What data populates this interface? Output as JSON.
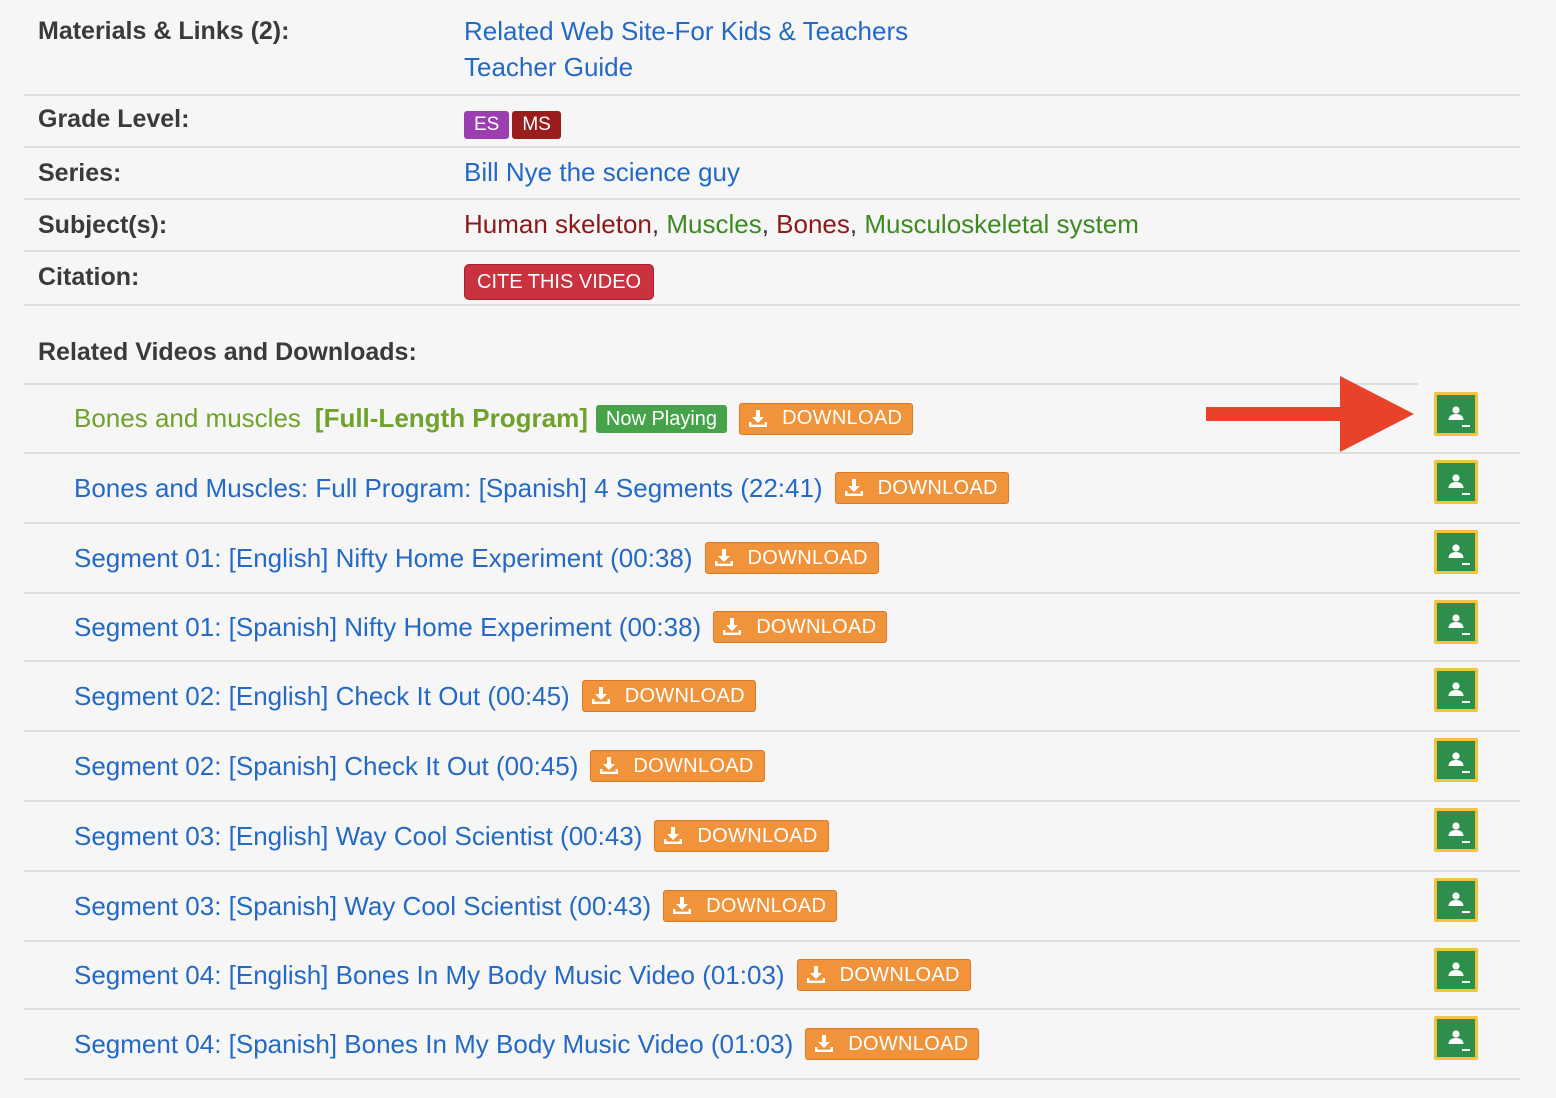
{
  "materials": {
    "label": "Materials & Links (2):",
    "links": [
      "Related Web Site-For Kids & Teachers",
      "Teacher Guide"
    ]
  },
  "grade": {
    "label": "Grade Level:",
    "badges": [
      {
        "text": "ES",
        "color": "#9b3fb0"
      },
      {
        "text": "MS",
        "color": "#9a1c1c"
      }
    ]
  },
  "series": {
    "label": "Series:",
    "value": "Bill Nye the science guy"
  },
  "subjects": {
    "label": "Subject(s):",
    "items": [
      "Human skeleton",
      "Muscles",
      "Bones",
      "Musculoskeletal system"
    ],
    "separator": ", "
  },
  "citation": {
    "label": "Citation:",
    "button": "CITE THIS VIDEO"
  },
  "related": {
    "title": "Related Videos and Downloads:",
    "download_label": "DOWNLOAD",
    "now_playing_label": "Now Playing",
    "full_length_label": "[Full-Length Program]",
    "videos": [
      "Bones and muscles",
      "Bones and Muscles: Full Program: [Spanish] 4 Segments (22:41)",
      "Segment 01: [English] Nifty Home Experiment (00:38)",
      "Segment 01: [Spanish] Nifty Home Experiment (00:38)",
      "Segment 02: [English] Check It Out (00:45)",
      "Segment 02: [Spanish] Check It Out (00:45)",
      "Segment 03: [English] Way Cool Scientist (00:43)",
      "Segment 03: [Spanish] Way Cool Scientist (00:43)",
      "Segment 04: [English] Bones In My Body Music Video (01:03)",
      "Segment 04: [Spanish] Bones In My Body Music Video (01:03)"
    ]
  },
  "colors": {
    "link": "#2469c4",
    "playing": "#6ea22a",
    "download": "#f0933a",
    "now_playing": "#46a34a",
    "cite": "#c9323e",
    "classroom": "#2e8f4c",
    "arrow": "#e8422a"
  }
}
